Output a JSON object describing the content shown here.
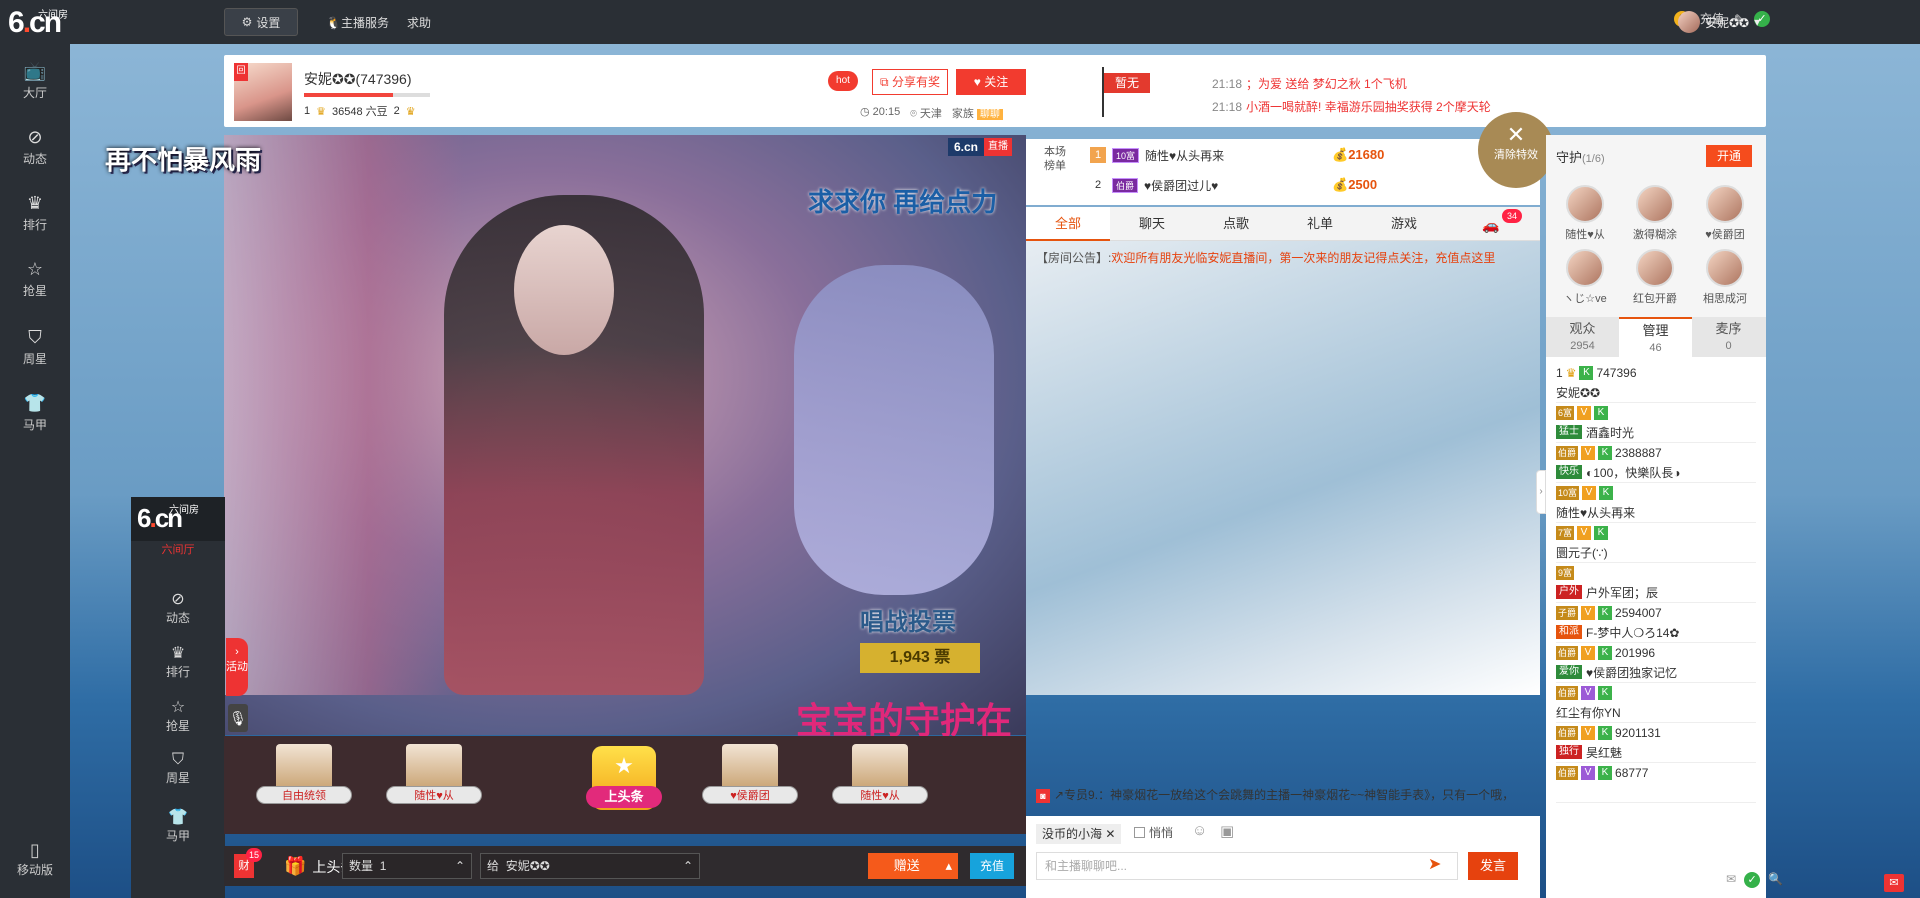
{
  "topbar": {
    "logo_main": "6.cn",
    "logo_sub": "六间房",
    "settings_label": "设置",
    "anchor_service": "主播服务",
    "help": "求助",
    "recharge": "充值",
    "username": "安妮✪✪"
  },
  "leftnav": {
    "items": [
      {
        "icon": "tv-icon",
        "label": "大厅"
      },
      {
        "icon": "compass-icon",
        "label": "动态"
      },
      {
        "icon": "crown-icon",
        "label": "排行"
      },
      {
        "icon": "star-icon",
        "label": "抢星"
      },
      {
        "icon": "basket-icon",
        "label": "周星"
      },
      {
        "icon": "shirt-icon",
        "label": "马甲"
      }
    ],
    "mobile": "移动版"
  },
  "anchor": {
    "name": "安妮✪✪(747396)",
    "level_left": "1",
    "beans": "36548 六豆",
    "level_right": "2",
    "progress": 0.71,
    "hot": "hot",
    "share": "分享有奖",
    "follow": "关注",
    "time": "20:15",
    "city": "天津",
    "family": "家族",
    "family_tag": "聊聊",
    "flag": "暂无"
  },
  "marquee": [
    {
      "time": "21:18",
      "text": "；为爱 送给 梦幻之秋 1个飞机"
    },
    {
      "time": "21:18",
      "text": "小酒一喝就醉! 幸福游乐园抽奖获得 2个摩天轮"
    }
  ],
  "video": {
    "overlay_title": "再不怕暴风雨",
    "overlay_begs": "求求你 再给点力",
    "badge_site": "6.cn",
    "badge_live": "直播",
    "vote_title": "唱战投票",
    "vote_count": "1,943 票",
    "guard_text": "宝宝的守护在",
    "activity": "活动"
  },
  "subnav": {
    "logo_main": "6.cn",
    "logo_sub": "六间房",
    "lobby": "六间厅",
    "items": [
      "动态",
      "排行",
      "抢星",
      "周星",
      "马甲"
    ]
  },
  "rankstrip": [
    {
      "name": "自由统领"
    },
    {
      "name": "随性♥从"
    },
    {
      "name": "上头条"
    },
    {
      "name": "♥侯爵团"
    },
    {
      "name": "随性♥从"
    }
  ],
  "giftbar": {
    "rich": "财",
    "rich_count": "15",
    "headline": "上头条",
    "qty_label": "数量",
    "qty_value": "1",
    "to_label": "给",
    "to_value": "安妮✪✪",
    "send": "赠送",
    "recharge": "充值"
  },
  "rank_board": {
    "label": "本场榜单",
    "rows": [
      {
        "rank": "1",
        "lvl": "10富",
        "name": "随性♥从头再来",
        "amount": "21680"
      },
      {
        "rank": "2",
        "lvl": "伯爵",
        "name": "♥侯爵团过儿♥",
        "amount": "2500"
      }
    ]
  },
  "chat_tabs": {
    "tabs": [
      "全部",
      "聊天",
      "点歌",
      "礼单",
      "游戏"
    ],
    "car_count": "34"
  },
  "clear_fx": "清除特效",
  "notice": {
    "key": "【房间公告】:",
    "value": "欢迎所有朋友光临安妮直播间，第一次来的朋友记得点关注，充值点这里"
  },
  "chat_msg": "↗专员9.：神豪烟花一放给这个会跳舞的主播一神豪烟花~~神智能手表》，只有一个哦，",
  "chat_input": {
    "chip": "没币的小海",
    "whisper": "悄悄",
    "placeholder": "和主播聊聊吧...",
    "send": "发言"
  },
  "guards": {
    "title": "守护",
    "count": "(1/6)",
    "open": "开通",
    "list": [
      "随性♥从",
      "激得糊涂",
      "♥侯爵团",
      "ヽじ☆ve",
      "红包开爵",
      "相思成河"
    ]
  },
  "viewer_tabs": [
    {
      "label": "观众",
      "count": "2954"
    },
    {
      "label": "管理",
      "count": "46"
    },
    {
      "label": "麦序",
      "count": "0"
    }
  ],
  "viewers": [
    {
      "id": "747396",
      "name": "安妮✪✪",
      "lvl": "1",
      "fam": ""
    },
    {
      "id": "",
      "name": "酒鑫时光",
      "lvl": "6富",
      "fam": "猛士"
    },
    {
      "id": "2388887",
      "name": "◐100，快樂队長◑",
      "lvl": "伯爵",
      "fam": "快乐"
    },
    {
      "id": "",
      "name": "随性♥从头再来",
      "lvl": "10富",
      "fam": ""
    },
    {
      "id": "",
      "name": "圜元子(∵)",
      "lvl": "7富",
      "fam": ""
    },
    {
      "id": "",
      "name": "户外军团；辰",
      "lvl": "9富",
      "fam": "户外"
    },
    {
      "id": "2594007",
      "name": "F-梦中人❍ろ14✿",
      "lvl": "子爵",
      "fam": "和派"
    },
    {
      "id": "201996",
      "name": "♥侯爵团独家记忆",
      "lvl": "伯爵",
      "fam": "爱你"
    },
    {
      "id": "",
      "name": "红尘有你YN",
      "lvl": "伯爵",
      "fam": ""
    },
    {
      "id": "9201131",
      "name": "昊红魅",
      "lvl": "伯爵",
      "fam": "独行"
    },
    {
      "id": "68777",
      "name": "",
      "lvl": "伯爵",
      "fam": ""
    }
  ]
}
